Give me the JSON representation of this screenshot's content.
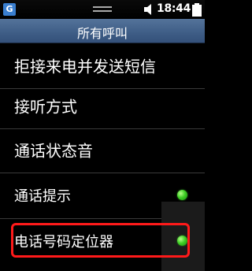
{
  "status_bar": {
    "app_badge": "G",
    "time": "18:44",
    "icons": [
      "app-badge-icon",
      "drag-handle-icon",
      "volume-icon",
      "battery-icon"
    ]
  },
  "header": {
    "title": "所有呼叫"
  },
  "menu": {
    "items": [
      {
        "label": "拒接来电并发送短信"
      },
      {
        "label": "接听方式"
      },
      {
        "label": "通话状态音"
      },
      {
        "label": "通话提示",
        "toggle": "on"
      },
      {
        "label": "电话号码定位器",
        "toggle": "on"
      }
    ]
  },
  "colors": {
    "title_bar": "#466791",
    "toggle_on": "#3fcf26",
    "highlight": "#ff1a1a"
  }
}
